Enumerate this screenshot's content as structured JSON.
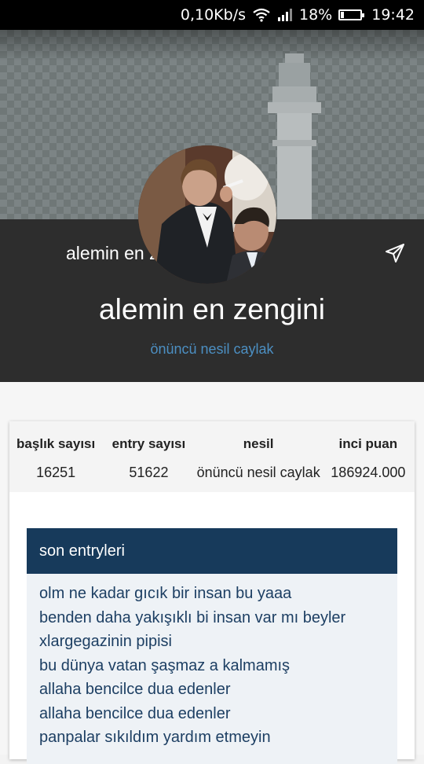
{
  "status_bar": {
    "network_speed": "0,10Kb/s",
    "battery_percent": "18%",
    "battery_level": 0.18,
    "time": "19:42",
    "icons": [
      "wifi-icon",
      "signal-icon",
      "battery-icon"
    ]
  },
  "profile": {
    "toolbar_title": "alemin en zengini",
    "name": "alemin en zengini",
    "generation_label": "önüncü nesil caylak"
  },
  "stats": [
    {
      "label": "başlık sayısı",
      "value": "16251"
    },
    {
      "label": "entry sayısı",
      "value": "51622"
    },
    {
      "label": "nesil",
      "value": "önüncü nesil caylak"
    },
    {
      "label": "inci puan",
      "value": "186924.000"
    }
  ],
  "entries": {
    "heading": "son entryleri",
    "items": [
      "olm ne kadar gıcık bir insan bu yaaa",
      "benden daha yakışıklı bi insan var mı beyler",
      "xlargegazinin pipisi",
      "bu dünya vatan şaşmaz a kalmamış",
      "allaha bencilce dua edenler",
      "allaha bencilce dua edenler",
      "panpalar sıkıldım yardım etmeyin"
    ]
  },
  "colors": {
    "header_bg": "#2d2d2d",
    "accent_blue": "#4c8fc2",
    "entries_head_bg": "#173a5b",
    "entry_text": "#1d3f63"
  }
}
